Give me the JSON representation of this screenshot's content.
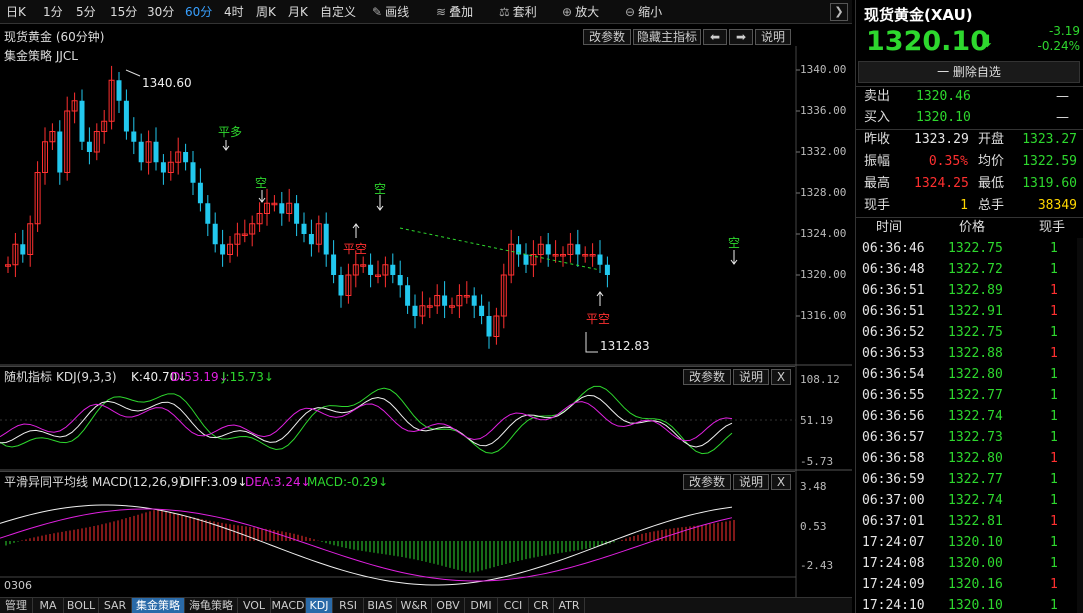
{
  "toolbar": {
    "periods": [
      "日K",
      "1分",
      "5分",
      "15分",
      "30分",
      "60分",
      "4时",
      "周K",
      "月K",
      "自定义"
    ],
    "active_period": "60分",
    "tools": [
      {
        "icon": "pencil-icon",
        "glyph": "✎",
        "label": "画线"
      },
      {
        "icon": "layers-icon",
        "glyph": "≋",
        "label": "叠加"
      },
      {
        "icon": "arbitrage-icon",
        "glyph": "⚖",
        "label": "套利"
      },
      {
        "icon": "zoom-in-icon",
        "glyph": "⊕",
        "label": "放大"
      },
      {
        "icon": "zoom-out-icon",
        "glyph": "⊖",
        "label": "缩小"
      }
    ],
    "more_glyph": "❯"
  },
  "main_panel": {
    "title": "现货黄金 (60分钟)",
    "strategy": "集金策略 JJCL",
    "buttons": {
      "change_params": "改参数",
      "hide_indicator": "隐藏主指标",
      "prev": "⬅",
      "next": "➡",
      "help": "说明"
    },
    "high_label": "1340.60",
    "low_label": "1312.83",
    "price_axis": [
      "1340.00",
      "1336.00",
      "1332.00",
      "1328.00",
      "1324.00",
      "1320.00",
      "1316.00"
    ],
    "signals": [
      {
        "text": "平多",
        "color": "#2ed82e"
      },
      {
        "text": "空",
        "color": "#2ed82e"
      },
      {
        "text": "空",
        "color": "#2ed82e"
      },
      {
        "text": "平空",
        "color": "#ff3030"
      },
      {
        "text": "平空",
        "color": "#ff3030"
      },
      {
        "text": "空",
        "color": "#2ed82e"
      }
    ]
  },
  "kdj_panel": {
    "name": "随机指标",
    "params": "KDJ(9,3,3)",
    "k": "K:40.70↓",
    "d": "D:53.19↓",
    "j": "J:15.73↓",
    "buttons": {
      "change_params": "改参数",
      "help": "说明",
      "close": "X"
    },
    "axis": [
      "108.12",
      "51.19",
      "-5.73"
    ]
  },
  "macd_panel": {
    "name": "平滑异同平均线",
    "params": "MACD(12,26,9)",
    "diff": "DIFF:3.09↓",
    "dea": "DEA:3.24↓",
    "macd": "MACD:-0.29↓",
    "buttons": {
      "change_params": "改参数",
      "help": "说明",
      "close": "X"
    },
    "axis": [
      "3.48",
      "0.53",
      "-2.43"
    ]
  },
  "date_label": "0306",
  "bottom_tabs": [
    "管理",
    "MA",
    "BOLL",
    "SAR",
    "集金策略",
    "海龟策略",
    "VOL",
    "MACD",
    "KDJ",
    "RSI",
    "BIAS",
    "W&R",
    "OBV",
    "DMI",
    "CCI",
    "CR",
    "ATR"
  ],
  "bottom_tabs_active": [
    "集金策略",
    "KDJ"
  ],
  "quote": {
    "name": "现货黄金(XAU)",
    "price": "1320.10",
    "arrow": "⬇",
    "change": "-3.19",
    "change_pct": "-0.24%",
    "remove_watch": "一 删除自选",
    "sell_label": "卖出",
    "sell": "1320.46",
    "sell_vol": "—",
    "buy_label": "买入",
    "buy": "1320.10",
    "buy_vol": "—",
    "stats": [
      {
        "l1": "昨收",
        "v1": "1323.29",
        "c1": "white",
        "l2": "开盘",
        "v2": "1323.27",
        "c2": "green"
      },
      {
        "l1": "振幅",
        "v1": "0.35%",
        "c1": "red",
        "l2": "均价",
        "v2": "1322.59",
        "c2": "green"
      },
      {
        "l1": "最高",
        "v1": "1324.25",
        "c1": "red",
        "l2": "最低",
        "v2": "1319.60",
        "c2": "green"
      },
      {
        "l1": "现手",
        "v1": "1",
        "c1": "yellow",
        "l2": "总手",
        "v2": "38349",
        "c2": "yellow"
      }
    ],
    "ticks_header": [
      "时间",
      "价格",
      "现手"
    ],
    "ticks": [
      {
        "t": "06:36:46",
        "p": "1322.75",
        "v": "1",
        "vc": "green"
      },
      {
        "t": "06:36:48",
        "p": "1322.72",
        "v": "1",
        "vc": "green"
      },
      {
        "t": "06:36:51",
        "p": "1322.89",
        "v": "1",
        "vc": "red"
      },
      {
        "t": "06:36:51",
        "p": "1322.91",
        "v": "1",
        "vc": "red"
      },
      {
        "t": "06:36:52",
        "p": "1322.75",
        "v": "1",
        "vc": "green"
      },
      {
        "t": "06:36:53",
        "p": "1322.88",
        "v": "1",
        "vc": "red"
      },
      {
        "t": "06:36:54",
        "p": "1322.80",
        "v": "1",
        "vc": "green"
      },
      {
        "t": "06:36:55",
        "p": "1322.77",
        "v": "1",
        "vc": "green"
      },
      {
        "t": "06:36:56",
        "p": "1322.74",
        "v": "1",
        "vc": "green"
      },
      {
        "t": "06:36:57",
        "p": "1322.73",
        "v": "1",
        "vc": "green"
      },
      {
        "t": "06:36:58",
        "p": "1322.80",
        "v": "1",
        "vc": "red"
      },
      {
        "t": "06:36:59",
        "p": "1322.77",
        "v": "1",
        "vc": "green"
      },
      {
        "t": "06:37:00",
        "p": "1322.74",
        "v": "1",
        "vc": "green"
      },
      {
        "t": "06:37:01",
        "p": "1322.81",
        "v": "1",
        "vc": "red"
      },
      {
        "t": "17:24:07",
        "p": "1320.10",
        "v": "1",
        "vc": "green"
      },
      {
        "t": "17:24:08",
        "p": "1320.00",
        "v": "1",
        "vc": "green"
      },
      {
        "t": "17:24:09",
        "p": "1320.16",
        "v": "1",
        "vc": "red"
      },
      {
        "t": "17:24:10",
        "p": "1320.10",
        "v": "1",
        "vc": "green"
      }
    ]
  },
  "colors": {
    "up": "#ff3030",
    "down": "#22c8ee",
    "green": "#2ed82e",
    "accent": "#38a0ff",
    "yellow": "#ffd700",
    "magenta": "#e020e0"
  }
}
